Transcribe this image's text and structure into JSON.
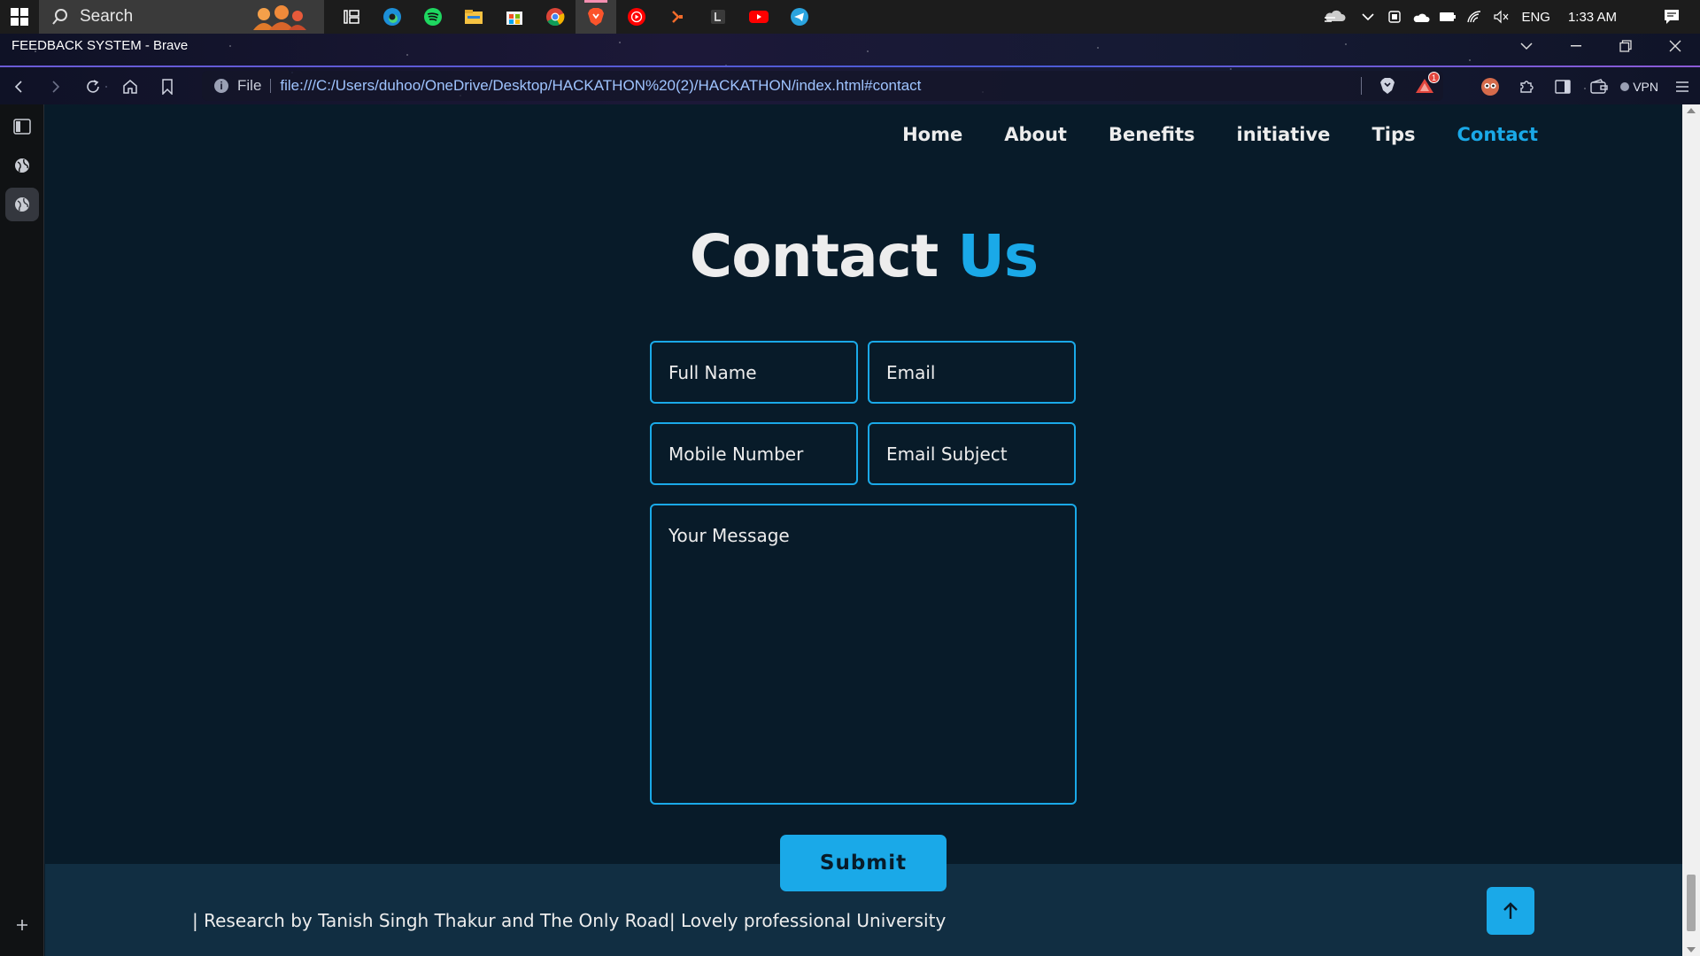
{
  "taskbar": {
    "search_placeholder": "Search",
    "apps": [
      "task-view-icon",
      "edge-icon",
      "spotify-icon",
      "file-explorer-icon",
      "microsoft-store-icon",
      "chrome-icon",
      "brave-icon",
      "youtube-music-icon",
      "app-arrow-icon",
      "app-l-icon",
      "youtube-icon",
      "telegram-icon"
    ],
    "tray": {
      "language": "ENG",
      "time": "1:33 AM"
    }
  },
  "browser": {
    "window_title": "FEEDBACK SYSTEM - Brave",
    "url_scheme": "File",
    "url": "file:///C:/Users/duhoo/OneDrive/Desktop/HACKATHON%20(2)/HACKATHON/index.html#contact",
    "shields_badge": "1",
    "vpn_label": "VPN"
  },
  "nav": {
    "items": [
      "Home",
      "About",
      "Benefits",
      "initiative",
      "Tips",
      "Contact"
    ],
    "active": "Contact"
  },
  "contact": {
    "title_main": "Contact",
    "title_highlight": "Us",
    "fields": {
      "full_name": "Full Name",
      "email": "Email",
      "mobile": "Mobile Number",
      "subject": "Email Subject",
      "message": "Your Message"
    },
    "submit_label": "Submit"
  },
  "footer": {
    "text": "| Research by Tanish Singh Thakur and The Only Road| Lovely professional University"
  },
  "colors": {
    "background": "#081b29",
    "accent": "#1aa9e8",
    "text": "#ededed",
    "footer_bg": "#112e42"
  }
}
